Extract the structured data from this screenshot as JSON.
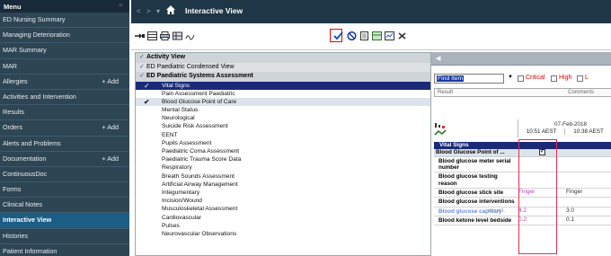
{
  "menu": {
    "title": "Menu",
    "pin_icon": "pin-icon",
    "items": [
      {
        "label": "ED Nursing Summary",
        "active": false,
        "add": ""
      },
      {
        "label": "Managing Deterioration",
        "active": false,
        "add": ""
      },
      {
        "label": "MAR Summary",
        "active": false,
        "add": ""
      },
      {
        "label": "MAR",
        "active": false,
        "add": ""
      },
      {
        "label": "Allergies",
        "active": false,
        "add": "+ Add"
      },
      {
        "label": "Activities and Intervention",
        "active": false,
        "add": ""
      },
      {
        "label": "Results",
        "active": false,
        "add": ""
      },
      {
        "label": "Orders",
        "active": false,
        "add": "+ Add"
      },
      {
        "label": "Alerts and Problems",
        "active": false,
        "add": ""
      },
      {
        "label": "Documentation",
        "active": false,
        "add": "+ Add"
      },
      {
        "label": "ContinuousDoc",
        "active": false,
        "add": ""
      },
      {
        "label": "Forms",
        "active": false,
        "add": ""
      },
      {
        "label": "Clinical Notes",
        "active": false,
        "add": ""
      },
      {
        "label": "Interactive View",
        "active": true,
        "add": ""
      },
      {
        "label": "Histories",
        "active": false,
        "add": ""
      },
      {
        "label": "Patient Information",
        "active": false,
        "add": ""
      }
    ]
  },
  "titlebar": {
    "back": "<",
    "forward": ">",
    "dropdown": "▾",
    "title": "Interactive View"
  },
  "navigator": {
    "bands": [
      {
        "label": "Activity View"
      },
      {
        "label": "ED Paediatric Condensed View"
      },
      {
        "label": "ED Paediatric Systems Assessment"
      }
    ],
    "items": [
      {
        "label": "Vital Signs",
        "state": "selected",
        "mark": "✓"
      },
      {
        "label": "Pain Assessment Paediatric",
        "state": "",
        "mark": ""
      },
      {
        "label": "Blood Glucose Point of Care",
        "state": "alt",
        "mark": "✔"
      },
      {
        "label": "Mental Status",
        "state": "",
        "mark": ""
      },
      {
        "label": "Neurological",
        "state": "",
        "mark": ""
      },
      {
        "label": "Suicide Risk Assessment",
        "state": "",
        "mark": ""
      },
      {
        "label": "EENT",
        "state": "",
        "mark": ""
      },
      {
        "label": "Pupils Assessment",
        "state": "",
        "mark": ""
      },
      {
        "label": "Paediatric Coma Assessment",
        "state": "",
        "mark": ""
      },
      {
        "label": "Paediatric Trauma Score Data",
        "state": "",
        "mark": ""
      },
      {
        "label": "Respiratory",
        "state": "",
        "mark": ""
      },
      {
        "label": "Breath Sounds Assessment",
        "state": "",
        "mark": ""
      },
      {
        "label": "Artificial Airway Management",
        "state": "",
        "mark": ""
      },
      {
        "label": "Integumentary",
        "state": "",
        "mark": ""
      },
      {
        "label": "Incision/Wound",
        "state": "",
        "mark": ""
      },
      {
        "label": "Musculoskeletal Assessment",
        "state": "",
        "mark": ""
      },
      {
        "label": "Cardiovascular",
        "state": "",
        "mark": ""
      },
      {
        "label": "Pulses",
        "state": "",
        "mark": ""
      },
      {
        "label": "Neurovascular Observations",
        "state": "",
        "mark": ""
      }
    ]
  },
  "right": {
    "find_value": "Find Item",
    "filters": [
      "Critical",
      "High",
      "L"
    ],
    "result_label": "Result",
    "comments_label": "Comments",
    "date": "07-Feb-2018",
    "time1": "10:51 AEST",
    "time2": "10:38 AEST",
    "section": "Vital Signs",
    "subsection": "Blood Glucose Point of ...",
    "rows": [
      {
        "label": "Blood glucose meter serial number",
        "unit": "",
        "v1": "",
        "v2": "",
        "blue": false
      },
      {
        "label": "Blood glucose testing reason",
        "unit": "",
        "v1": "",
        "v2": "",
        "blue": false
      },
      {
        "label": "Blood glucose stick site",
        "unit": "",
        "v1": "Finger",
        "v2": "Finger",
        "blue": false
      },
      {
        "label": "Blood glucose interventions",
        "unit": "",
        "v1": "",
        "v2": "",
        "blue": false
      },
      {
        "label": "Blood glucose capillary",
        "unit": "mmol/L",
        "v1": "4.2",
        "v2": "3.0",
        "blue": true
      },
      {
        "label": "Blood ketone level bedside",
        "unit": "",
        "v1": "0.2",
        "v2": "0.1",
        "blue": false
      }
    ]
  },
  "colors": {
    "menu_bg": "#2e4554",
    "menu_active": "#1c5d86",
    "selection": "#1b2a78",
    "highlight_box": "#e03050"
  }
}
